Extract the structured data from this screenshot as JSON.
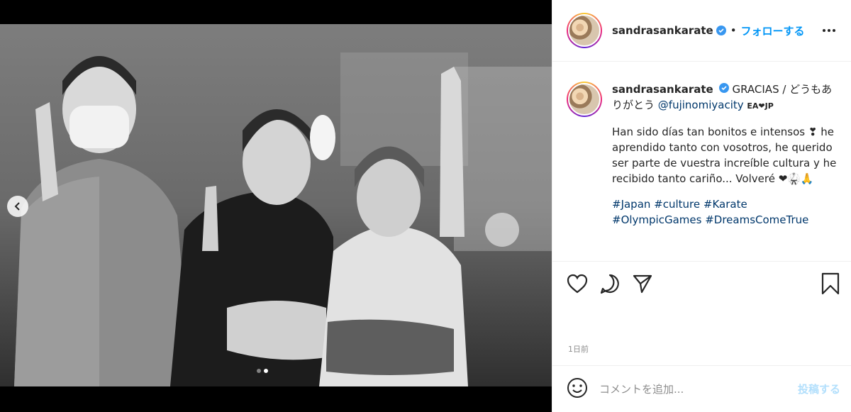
{
  "post": {
    "username": "sandrasankarate",
    "follow_label": "フォローする",
    "bullet": "•",
    "caption_lead": "GRACIAS / どうもありがとう",
    "caption_mention": "@fujinomiyacity",
    "caption_tag": "EA❤JP",
    "caption_body": "Han sido días tan bonitos e intensos ❣ he aprendido tanto con vosotros, he querido ser parte de vuestra increíble cultura y he recibido tanto cariño... Volveré ❤🥋🙏",
    "hashtags": "#Japan #culture #Karate #OlympicGames #DreamsComeTrue",
    "time_ago": "1日前"
  },
  "comment": {
    "placeholder": "コメントを追加...",
    "post_label": "投稿する"
  },
  "icons": {
    "verified": "verified-badge-icon",
    "like": "heart-icon",
    "comment": "speech-bubble-icon",
    "share": "paper-plane-icon",
    "save": "bookmark-icon",
    "emoji": "smiley-icon",
    "more": "ellipsis-icon",
    "prev": "chevron-left-icon"
  },
  "colors": {
    "link": "#0095f6",
    "mention": "#00376b",
    "muted": "#8e8e8e",
    "post_disabled": "#b2dffc"
  },
  "carousel": {
    "slide_count": 2,
    "active_index": 1
  }
}
